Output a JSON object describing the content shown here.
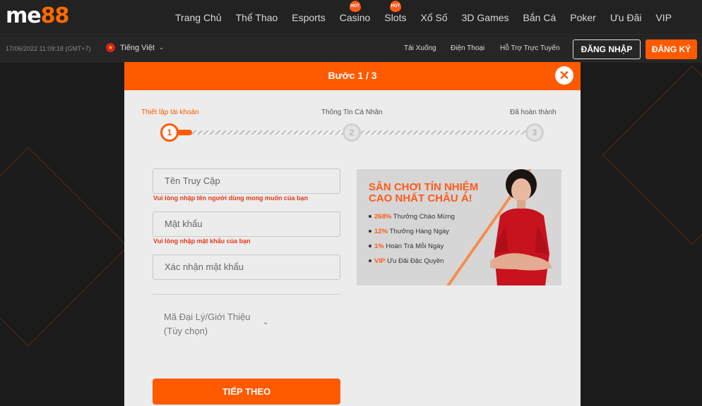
{
  "brand": {
    "logo_part1": "me",
    "logo_part2": "88"
  },
  "nav": {
    "items": [
      {
        "label": "Trang Chủ",
        "badge": ""
      },
      {
        "label": "Thể Thao",
        "badge": ""
      },
      {
        "label": "Esports",
        "badge": ""
      },
      {
        "label": "Casino",
        "badge": "HOT"
      },
      {
        "label": "Slots",
        "badge": "HOT"
      },
      {
        "label": "Xổ Số",
        "badge": ""
      },
      {
        "label": "3D Games",
        "badge": ""
      },
      {
        "label": "Bắn Cá",
        "badge": ""
      },
      {
        "label": "Poker",
        "badge": ""
      },
      {
        "label": "Ưu Đãi",
        "badge": ""
      },
      {
        "label": "VIP",
        "badge": ""
      }
    ]
  },
  "subbar": {
    "datetime": "17/06/2022 11:09:18 (GMT+7)",
    "language": "Tiếng Việt",
    "links": [
      "Tải Xuống",
      "Điện Thoại",
      "Hỗ Trợ Trực Tuyến"
    ],
    "login_label": "ĐĂNG NHẬP",
    "signup_label": "ĐĂNG KÝ"
  },
  "modal": {
    "title": "Bước 1 / 3",
    "close_symbol": "✕",
    "steps": [
      {
        "label": "Thiết lập tài khoản",
        "number": "1",
        "active": true
      },
      {
        "label": "Thông Tin Cá Nhân",
        "number": "2",
        "active": false
      },
      {
        "label": "Đã hoàn thành",
        "number": "3",
        "active": false
      }
    ],
    "progress_fraction": 0.05,
    "fields": {
      "username_placeholder": "Tên Truy Cập",
      "username_hint": "Vui lòng nhập tên người dùng mong muốn của bạn",
      "password_placeholder": "Mật khẩu",
      "password_hint": "Vui lòng nhập mật khẩu của bạn",
      "confirm_placeholder": "Xác nhận mật khẩu",
      "agent_label_line1": "Mã Đại Lý/Giới Thiệu",
      "agent_label_line2": "(Tùy chọn)"
    },
    "next_label": "TIẾP THEO",
    "promo": {
      "headline_line1": "SÂN CHƠI TÍN NHIỆM",
      "headline_line2": "CAO NHẤT CHÂU Á!",
      "items": [
        {
          "highlight": "268%",
          "text": "Thưởng Chào Mừng"
        },
        {
          "highlight": "12%",
          "text": "Thưởng Hàng Ngày"
        },
        {
          "highlight": "1%",
          "text": "Hoàn Trả Mỗi Ngày"
        },
        {
          "highlight": "VIP",
          "text": "Ưu Đãi Đặc Quyền"
        }
      ]
    }
  },
  "colors": {
    "accent": "#ff5a00",
    "background": "#1b1b1b",
    "modal_bg": "#ececec",
    "hint_red": "#e23a1a"
  }
}
